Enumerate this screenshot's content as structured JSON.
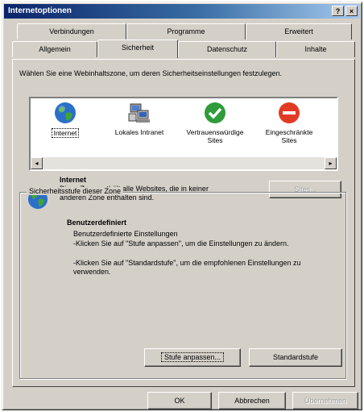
{
  "window": {
    "title": "Internetoptionen",
    "help_btn": "?",
    "close_btn": "×"
  },
  "tabs": {
    "row1": [
      "Verbindungen",
      "Programme",
      "Erweitert"
    ],
    "row2": [
      "Allgemein",
      "Sicherheit",
      "Datenschutz",
      "Inhalte"
    ],
    "active": "Sicherheit"
  },
  "security": {
    "instruction": "Wählen Sie eine Webinhaltszone, um deren Sicherheitseinstellungen festzulegen.",
    "zones": [
      {
        "label": "Internet",
        "icon": "globe-icon"
      },
      {
        "label": "Lokales Intranet",
        "icon": "intranet-computer-icon"
      },
      {
        "label": "Vertrauenswürdige Sites",
        "icon": "checkmark-icon"
      },
      {
        "label": "Eingeschränkte Sites",
        "icon": "restricted-icon"
      }
    ],
    "selected_zone": {
      "title": "Internet",
      "description": "Diese Zone enthält alle Websites, die in keiner anderen Zone enthalten sind."
    },
    "sites_button": "Sites...",
    "level_group": {
      "title": "Sicherheitsstufe dieser Zone",
      "level_name": "Benutzerdefiniert",
      "lines": [
        "Benutzerdefinierte Einstellungen",
        "-Klicken Sie auf \"Stufe anpassen\", um die Einstellungen zu ändern.",
        "-Klicken Sie auf \"Standardstufe\", um die empfohlenen Einstellungen zu verwenden."
      ],
      "custom_button": "Stufe anpassen...",
      "default_button": "Standardstufe"
    }
  },
  "footer": {
    "ok": "OK",
    "cancel": "Abbrechen",
    "apply": "Übernehmen"
  },
  "colors": {
    "title_start": "#0a246a",
    "title_end": "#a6caf0",
    "face": "#d4d0c8"
  }
}
